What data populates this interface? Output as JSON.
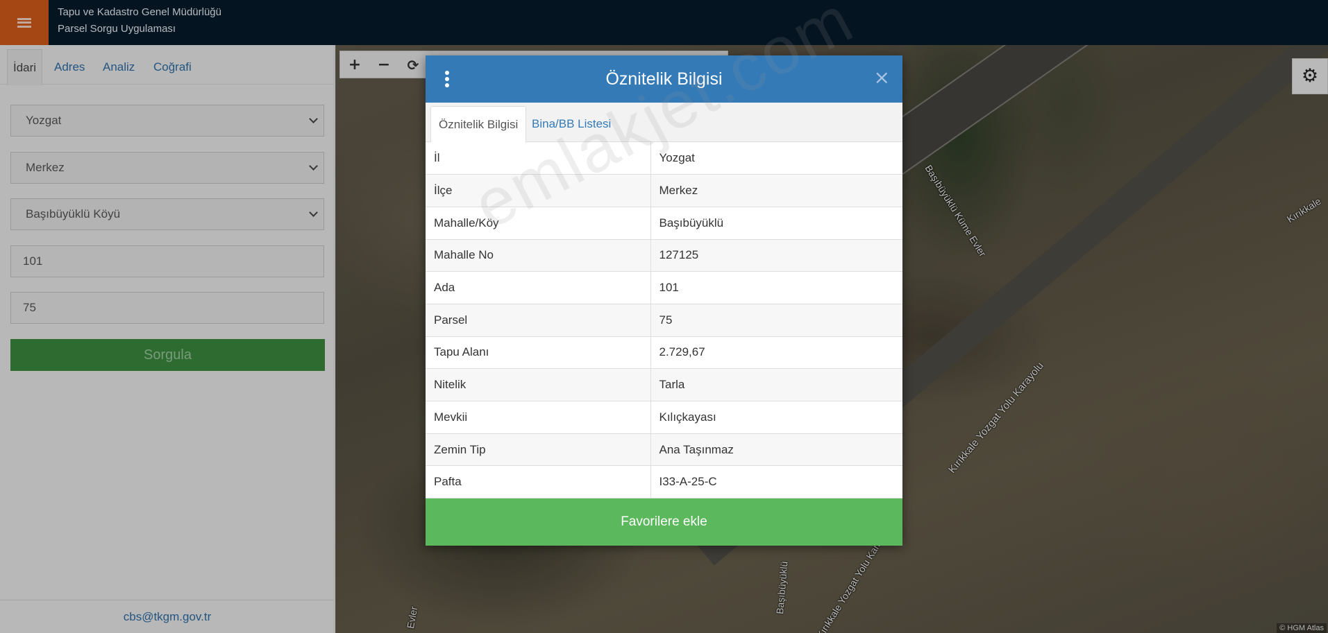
{
  "header": {
    "org_name": "Tapu ve Kadastro Genel Müdürlüğü",
    "app_name": "Parsel Sorgu Uygulaması",
    "menu_icon": "hamburger-menu-icon"
  },
  "sidebar": {
    "tabs": [
      {
        "label": "İdari",
        "active": true
      },
      {
        "label": "Adres",
        "active": false
      },
      {
        "label": "Analiz",
        "active": false
      },
      {
        "label": "Coğrafi",
        "active": false
      }
    ],
    "province_select": "Yozgat",
    "district_select": "Merkez",
    "neighborhood_select": "Başıbüyüklü Köyü",
    "ada_input": "101",
    "parsel_input": "75",
    "query_button": "Sorgula",
    "footer_email": "cbs@tkgm.gov.tr"
  },
  "map": {
    "toolbar": [
      {
        "icon": "zoom-in-icon",
        "glyph": "+"
      },
      {
        "icon": "zoom-out-icon",
        "glyph": "−"
      },
      {
        "icon": "refresh-icon",
        "glyph": "⟳"
      }
    ],
    "settings_icon": "gear-icon",
    "settings_glyph": "⚙",
    "labels": {
      "road_top_right": "Kırıkkale",
      "village_street": "Başıbüyüklü Küme Evler",
      "highway_center": "Kırıkkale Yozgat Yolu Karayolu",
      "highway_bottom": "Kırıkkale Yozgat Yolu Karayolu",
      "street_bottom": "Başıbüyüklü",
      "street_left": "Evler"
    },
    "attribution": "© HGM Atlas"
  },
  "modal": {
    "title": "Öznitelik Bilgisi",
    "close_glyph": "×",
    "tabs": [
      {
        "label": "Öznitelik Bilgisi",
        "active": true
      },
      {
        "label": "Bina/BB Listesi",
        "active": false
      }
    ],
    "rows": [
      {
        "key": "İl",
        "value": "Yozgat"
      },
      {
        "key": "İlçe",
        "value": "Merkez"
      },
      {
        "key": "Mahalle/Köy",
        "value": "Başıbüyüklü"
      },
      {
        "key": "Mahalle No",
        "value": "127125"
      },
      {
        "key": "Ada",
        "value": "101"
      },
      {
        "key": "Parsel",
        "value": "75"
      },
      {
        "key": "Tapu Alanı",
        "value": "2.729,67"
      },
      {
        "key": "Nitelik",
        "value": "Tarla"
      },
      {
        "key": "Mevkii",
        "value": "Kılıçkayası"
      },
      {
        "key": "Zemin Tip",
        "value": "Ana Taşınmaz"
      },
      {
        "key": "Pafta",
        "value": "I33-A-25-C"
      }
    ],
    "favorite_button": "Favorilere ekle",
    "watermark": "emlakjet.com"
  },
  "colors": {
    "topbar": "#061a2b",
    "menu_button": "#d35c1c",
    "modal_header": "#337ab7",
    "favorite_button": "#5cb85c",
    "query_button": "#3a8a3f",
    "link": "#337ab7"
  }
}
